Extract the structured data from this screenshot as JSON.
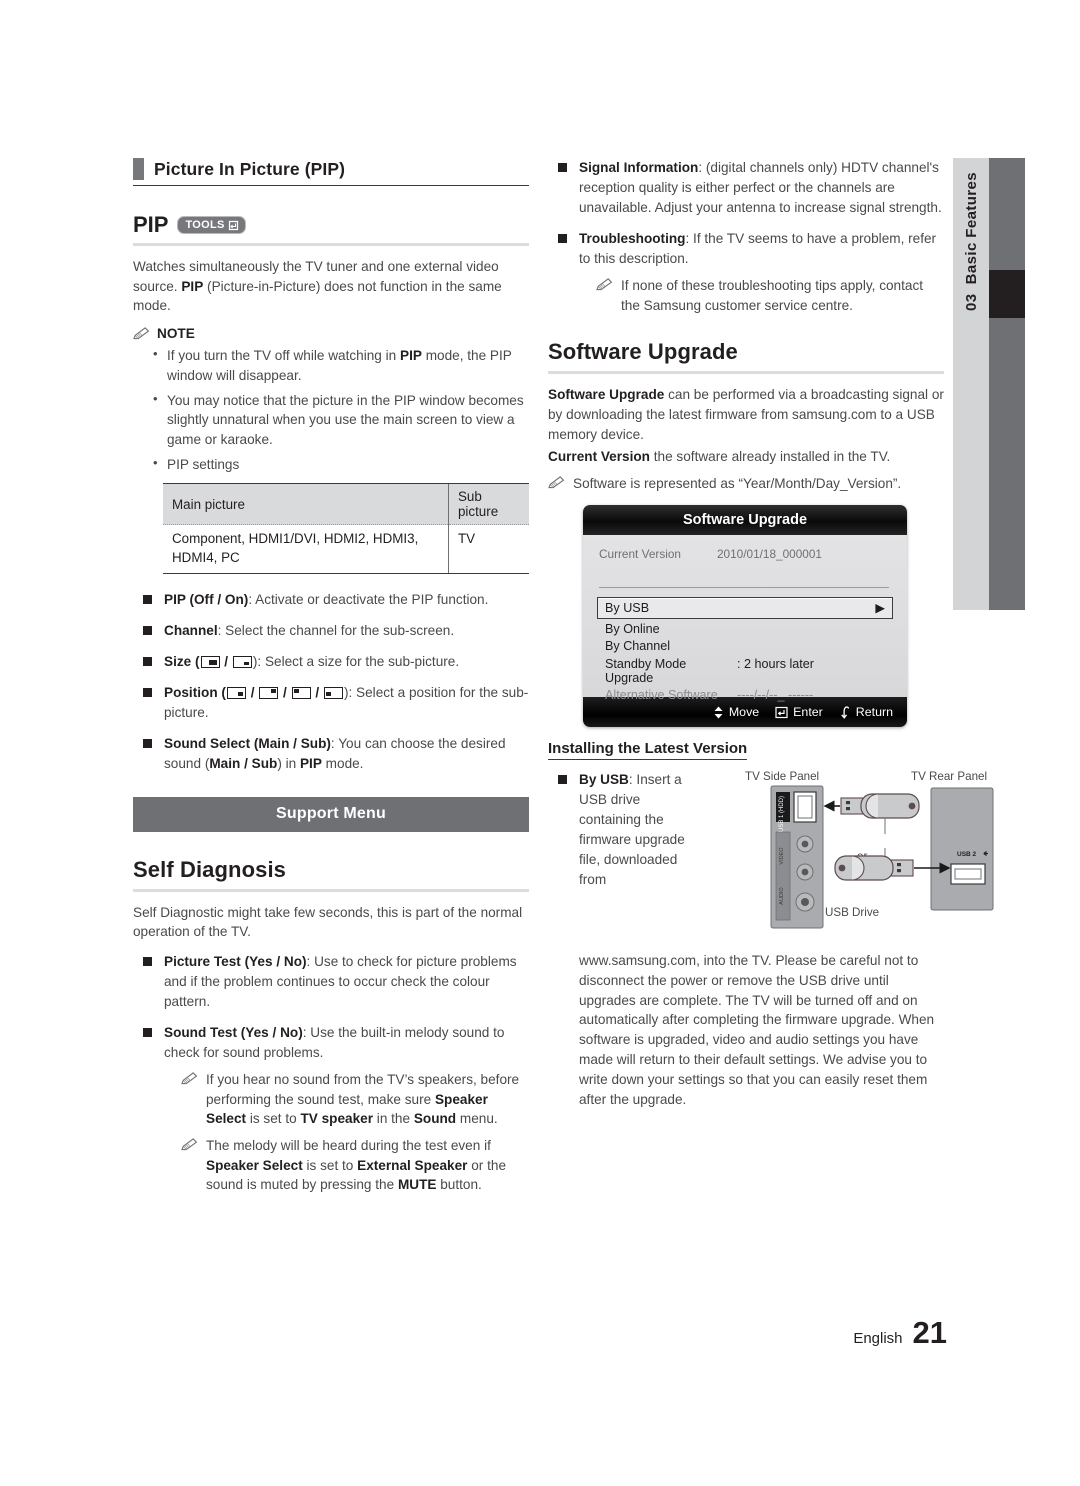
{
  "side_tab": {
    "number": "03",
    "label": "Basic Features"
  },
  "footer": {
    "language": "English",
    "page": "21"
  },
  "left": {
    "section_heading": "Picture In Picture (PIP)",
    "feature_title": "PIP",
    "tools_badge": "TOOLS",
    "intro_1": "Watches simultaneously the TV tuner and one external video source. ",
    "intro_2": "PIP",
    "intro_3": " (Picture-in-Picture) does not function in the same mode.",
    "note_label": "NOTE",
    "note_items": [
      {
        "a": "If you turn the TV off while watching in ",
        "b": "PIP",
        "c": " mode, the PIP window will disappear."
      },
      {
        "a": "You may notice that the picture in the PIP window becomes slightly unnatural when you use the main screen to view a game or karaoke.",
        "b": "",
        "c": ""
      },
      {
        "a": "PIP settings",
        "b": "",
        "c": ""
      }
    ],
    "table": {
      "headers": [
        "Main picture",
        "Sub picture"
      ],
      "rows": [
        [
          "Component, HDMI1/DVI, HDMI2, HDMI3, HDMI4, PC",
          "TV"
        ]
      ]
    },
    "features": [
      {
        "bold": "PIP (Off / On)",
        "rest": ": Activate or deactivate the PIP function."
      },
      {
        "bold": "Channel",
        "rest": ": Select the channel for the sub-screen."
      },
      {
        "bold": "Size",
        "rest": "): Select a size for the sub-picture."
      },
      {
        "bold": "Position",
        "rest": "): Select a position for the sub-picture."
      },
      {
        "bold": "Sound Select (Main / Sub)",
        "rest": ": You can choose the desired sound (",
        "mid": "Main / Sub",
        "tail": ") in ",
        "tail2": "PIP",
        "tail3": " mode."
      }
    ],
    "menu_bar": "Support Menu",
    "self_diag_heading": "Self Diagnosis",
    "self_diag_intro": "Self Diagnostic might take few seconds, this is part of the normal operation of the TV.",
    "diag_items": [
      {
        "bold": "Picture Test (Yes / No)",
        "rest": ": Use to check for picture problems and if the problem continues to occur check the colour pattern."
      },
      {
        "bold": "Sound Test (Yes / No)",
        "rest": ": Use the built-in melody sound to check for sound problems."
      }
    ],
    "diag_notes": [
      {
        "p1": "If you hear no sound from the TV’s speakers, before performing the sound test, make sure ",
        "b1": "Speaker Select",
        "p2": " is set to ",
        "b2": "TV speaker",
        "p3": " in the ",
        "b3": "Sound",
        "p4": " menu."
      },
      {
        "p1": "The melody will be heard during the test even if ",
        "b1": "Speaker Select",
        "p2": " is set to ",
        "b2": "External Speaker",
        "p3": " or the sound is muted by pressing the ",
        "b3": "MUTE",
        "p4": " button."
      }
    ]
  },
  "right": {
    "top_items": [
      {
        "bold": "Signal Information",
        "rest": ": (digital channels only) HDTV channel's reception quality is either perfect or the channels are unavailable. Adjust your antenna to increase signal strength."
      },
      {
        "bold": "Troubleshooting",
        "rest": ": If the TV seems to have a problem, refer to this description."
      }
    ],
    "troubleshoot_note": "If none of these troubleshooting tips apply, contact the Samsung customer service centre.",
    "sw_heading": "Software Upgrade",
    "sw_p1_bold": "Software Upgrade",
    "sw_p1_rest": " can be performed via a broadcasting signal or by downloading the latest firmware from samsung.com to a USB memory device.",
    "sw_p2_bold": "Current Version",
    "sw_p2_rest": " the software already installed in the TV.",
    "sw_note": "Software is represented as “Year/Month/Day_Version”.",
    "osd": {
      "title": "Software Upgrade",
      "current_version_label": "Current Version",
      "current_version_value": "2010/01/18_000001",
      "selected_item": "By USB",
      "rows": [
        {
          "label": "By Online",
          "value": ""
        },
        {
          "label": "By Channel",
          "value": ""
        },
        {
          "label": "Standby Mode Upgrade",
          "value": ": 2 hours later"
        },
        {
          "label": "Alternative Software",
          "value": "----/--/--_ ------"
        }
      ],
      "footer": [
        {
          "icon": "updown-arrow-icon",
          "label": "Move"
        },
        {
          "icon": "enter-icon",
          "label": "Enter"
        },
        {
          "icon": "return-icon",
          "label": "Return"
        }
      ]
    },
    "install_heading": "Installing the Latest Version",
    "usb_item_bold": "By USB",
    "usb_item_rest": ": Insert a USB drive containing the firmware upgrade file, downloaded from www.samsung.com, into the TV. Please be careful not to disconnect the power or remove the USB drive until upgrades are complete. The TV will be turned off and on automatically after completing the firmware upgrade. When software is upgraded, video and audio settings you have made will return to their default settings. We advise you to write down your settings so that you can easily reset them after the upgrade.",
    "diagram": {
      "side_panel_label": "TV Side Panel",
      "rear_panel_label": "TV Rear Panel",
      "usb_drive_label": "USB Drive",
      "or_label": "or",
      "usb1_label": "USB 1 (HDD)",
      "usb2_label": "USB 2",
      "video_label": "VIDEO",
      "audio_label": "AUDIO"
    }
  }
}
